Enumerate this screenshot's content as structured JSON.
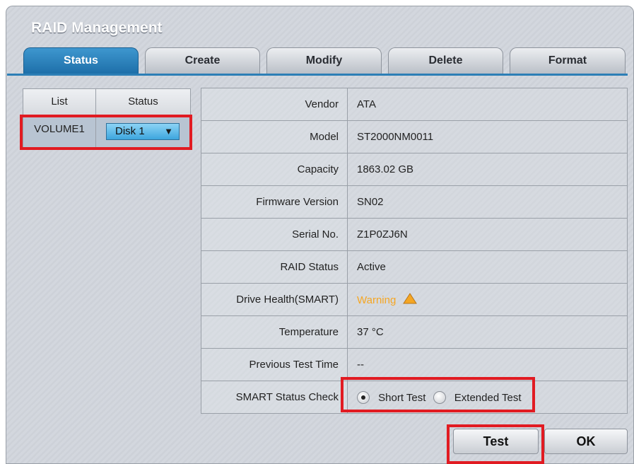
{
  "window": {
    "title": "RAID Management"
  },
  "tabs": [
    {
      "label": "Status",
      "active": true
    },
    {
      "label": "Create",
      "active": false
    },
    {
      "label": "Modify",
      "active": false
    },
    {
      "label": "Delete",
      "active": false
    },
    {
      "label": "Format",
      "active": false
    }
  ],
  "list_table": {
    "headers": [
      "List",
      "Status"
    ],
    "row": {
      "volume": "VOLUME1",
      "disk_selected": "Disk 1"
    }
  },
  "info": {
    "rows": [
      {
        "label": "Vendor",
        "value": "ATA"
      },
      {
        "label": "Model",
        "value": "ST2000NM0011"
      },
      {
        "label": "Capacity",
        "value": "1863.02 GB"
      },
      {
        "label": "Firmware Version",
        "value": "SN02"
      },
      {
        "label": "Serial No.",
        "value": "Z1P0ZJ6N"
      },
      {
        "label": "RAID Status",
        "value": "Active"
      },
      {
        "label": "Drive Health(SMART)",
        "value": "Warning"
      },
      {
        "label": "Temperature",
        "value": "37 °C"
      },
      {
        "label": "Previous Test Time",
        "value": "--"
      }
    ],
    "smart_check": {
      "label": "SMART Status Check",
      "options": [
        "Short Test",
        "Extended Test"
      ],
      "selected": "Short Test"
    }
  },
  "buttons": {
    "test": "Test",
    "ok": "OK"
  },
  "colors": {
    "accent": "#2d7fb6",
    "warning": "#f5a623",
    "highlight": "#e11b22"
  },
  "icons": {
    "warning": "warning-triangle-icon",
    "dropdown": "triangle-down-icon"
  }
}
